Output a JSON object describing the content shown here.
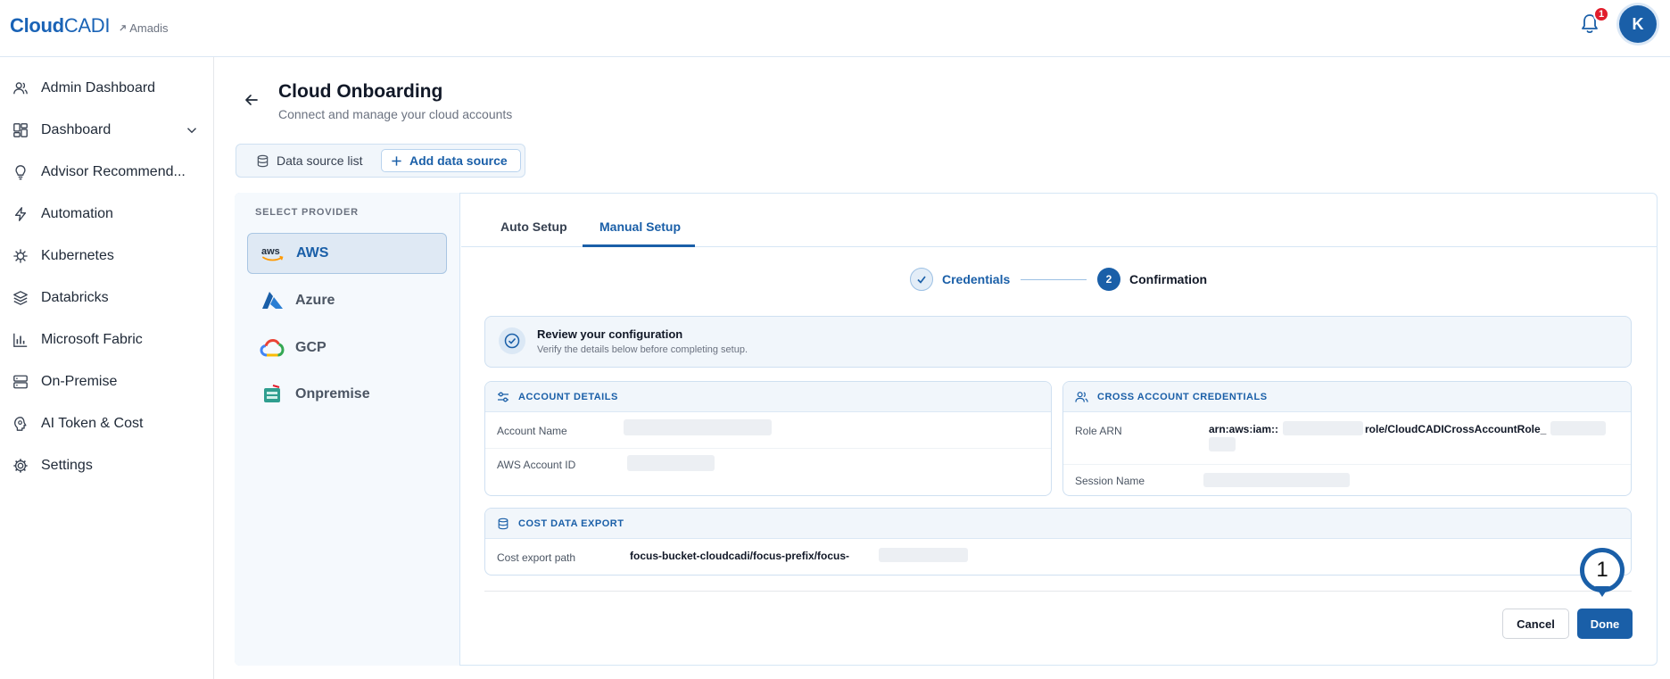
{
  "brand": {
    "name_bold": "Cloud",
    "name_light": "CADI",
    "workspace": "Amadis"
  },
  "header": {
    "notification_count": "1",
    "avatar_initial": "K"
  },
  "sidebar": {
    "items": [
      {
        "label": "Admin Dashboard",
        "icon": "users-icon"
      },
      {
        "label": "Dashboard",
        "icon": "dashboard-grid-icon"
      },
      {
        "label": "Advisor Recommend...",
        "icon": "lightbulb-icon"
      },
      {
        "label": "Automation",
        "icon": "bolt-icon"
      },
      {
        "label": "Kubernetes",
        "icon": "helm-icon"
      },
      {
        "label": "Databricks",
        "icon": "layers-icon"
      },
      {
        "label": "Microsoft Fabric",
        "icon": "bar-chart-icon"
      },
      {
        "label": "On-Premise",
        "icon": "server-icon"
      },
      {
        "label": "AI Token & Cost",
        "icon": "ai-token-icon"
      },
      {
        "label": "Settings",
        "icon": "gear-icon"
      }
    ]
  },
  "page": {
    "title": "Cloud Onboarding",
    "subtitle": "Connect and manage your cloud accounts"
  },
  "segment": {
    "list_label": "Data source list",
    "add_label": "Add data source"
  },
  "providers": {
    "heading": "SELECT PROVIDER",
    "items": [
      {
        "label": "AWS",
        "active": true
      },
      {
        "label": "Azure",
        "active": false
      },
      {
        "label": "GCP",
        "active": false
      },
      {
        "label": "Onpremise",
        "active": false
      }
    ]
  },
  "tabs": {
    "auto": "Auto Setup",
    "manual": "Manual Setup",
    "active": "Manual Setup"
  },
  "stepper": {
    "step1_label": "Credentials",
    "step2_number": "2",
    "step2_label": "Confirmation"
  },
  "review": {
    "title": "Review your configuration",
    "subtitle": "Verify the details below before completing setup."
  },
  "account_details": {
    "heading": "ACCOUNT DETAILS",
    "account_name_label": "Account Name",
    "aws_account_id_label": "AWS Account ID"
  },
  "cross_account": {
    "heading": "CROSS ACCOUNT CREDENTIALS",
    "role_arn_label": "Role ARN",
    "role_arn_prefix": "arn:aws:iam::",
    "role_arn_suffix": "role/CloudCADICrossAccountRole_",
    "session_name_label": "Session Name"
  },
  "cost_export": {
    "heading": "COST DATA EXPORT",
    "path_label": "Cost export path",
    "path_value": "focus-bucket-cloudcadi/focus-prefix/focus-"
  },
  "actions": {
    "cancel": "Cancel",
    "done": "Done"
  },
  "annotation": {
    "marker_number": "1"
  },
  "colors": {
    "accent": "#1a5fa8",
    "badge": "#e11d2c"
  }
}
